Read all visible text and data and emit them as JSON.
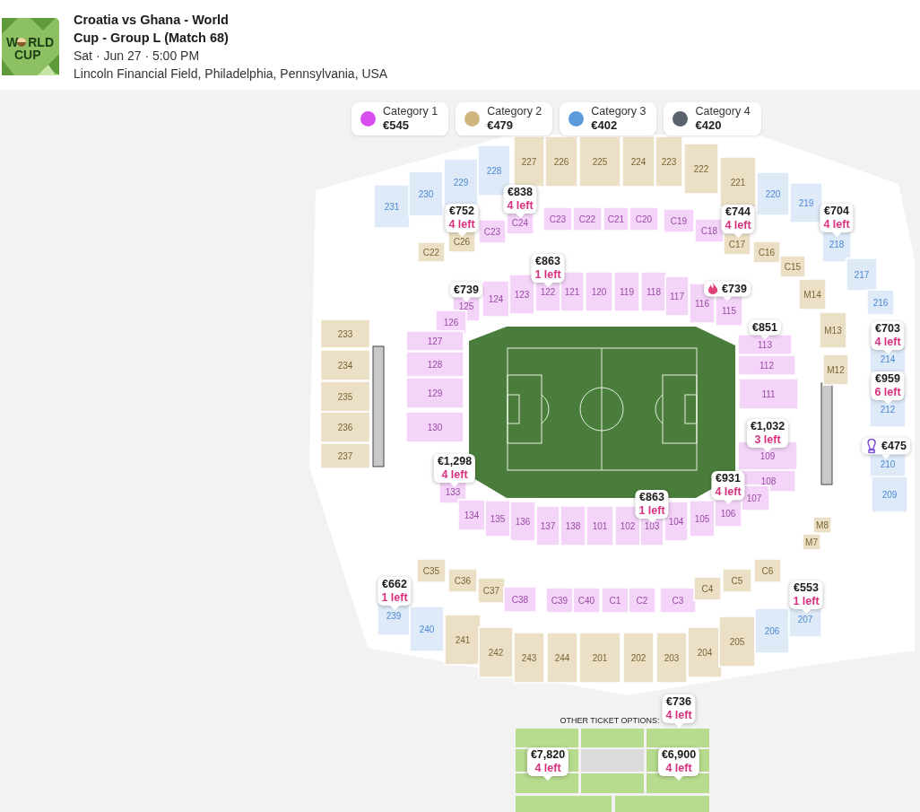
{
  "event": {
    "logo": {
      "line_1_start": "W",
      "line_1_end": "RLD",
      "line_2": "CUP"
    },
    "title": "Croatia vs Ghana - World Cup - Group L (Match 68)",
    "date": "Sat · Jun 27 · 5:00 PM",
    "venue": "Lincoln Financial Field, Philadelphia, Pennsylvania, USA"
  },
  "legend": [
    {
      "label": "Category 1",
      "price": "€545",
      "color": "#d94ef0"
    },
    {
      "label": "Category 2",
      "price": "€479",
      "color": "#cfb57e"
    },
    {
      "label": "Category 3",
      "price": "€402",
      "color": "#5b9bdc"
    },
    {
      "label": "Category 4",
      "price": "€420",
      "color": "#5a626e"
    }
  ],
  "upper_sections": [
    {
      "label": "231",
      "kind": "blue"
    },
    {
      "label": "230",
      "kind": "blue"
    },
    {
      "label": "229",
      "kind": "blue"
    },
    {
      "label": "228",
      "kind": "blue"
    },
    {
      "label": "227",
      "kind": "tan"
    },
    {
      "label": "226",
      "kind": "tan"
    },
    {
      "label": "225",
      "kind": "tan"
    },
    {
      "label": "224",
      "kind": "tan"
    },
    {
      "label": "223",
      "kind": "tan"
    },
    {
      "label": "222",
      "kind": "tan"
    },
    {
      "label": "221",
      "kind": "tan"
    },
    {
      "label": "220",
      "kind": "blue"
    },
    {
      "label": "219",
      "kind": "blue"
    },
    {
      "label": "218",
      "kind": "blue"
    },
    {
      "label": "217",
      "kind": "blue"
    },
    {
      "label": "216",
      "kind": "blue"
    },
    {
      "label": "214",
      "kind": "blue"
    },
    {
      "label": "212",
      "kind": "blue"
    },
    {
      "label": "210",
      "kind": "blue"
    },
    {
      "label": "209",
      "kind": "blue"
    },
    {
      "label": "233",
      "kind": "tan"
    },
    {
      "label": "234",
      "kind": "tan"
    },
    {
      "label": "235",
      "kind": "tan"
    },
    {
      "label": "236",
      "kind": "tan"
    },
    {
      "label": "237",
      "kind": "tan"
    },
    {
      "label": "239",
      "kind": "blue"
    },
    {
      "label": "240",
      "kind": "blue"
    },
    {
      "label": "241",
      "kind": "tan"
    },
    {
      "label": "242",
      "kind": "tan"
    },
    {
      "label": "243",
      "kind": "tan"
    },
    {
      "label": "244",
      "kind": "tan"
    },
    {
      "label": "201",
      "kind": "tan"
    },
    {
      "label": "202",
      "kind": "tan"
    },
    {
      "label": "203",
      "kind": "tan"
    },
    {
      "label": "204",
      "kind": "tan"
    },
    {
      "label": "205",
      "kind": "tan"
    },
    {
      "label": "206",
      "kind": "blue"
    },
    {
      "label": "207",
      "kind": "blue"
    }
  ],
  "club_sections": [
    {
      "label": "C22",
      "kind": "tan"
    },
    {
      "label": "C26",
      "kind": "tan"
    },
    {
      "label": "C23",
      "kind": "pink"
    },
    {
      "label": "C24",
      "kind": "pink"
    },
    {
      "label": "C23",
      "kind": "pink"
    },
    {
      "label": "C22",
      "kind": "pink"
    },
    {
      "label": "C21",
      "kind": "pink"
    },
    {
      "label": "C20",
      "kind": "pink"
    },
    {
      "label": "C19",
      "kind": "pink"
    },
    {
      "label": "C18",
      "kind": "pink"
    },
    {
      "label": "C17",
      "kind": "tan"
    },
    {
      "label": "C16",
      "kind": "tan"
    },
    {
      "label": "C15",
      "kind": "tan"
    },
    {
      "label": "M14",
      "kind": "tan"
    },
    {
      "label": "M13",
      "kind": "tan"
    },
    {
      "label": "M12",
      "kind": "tan"
    },
    {
      "label": "M8",
      "kind": "tan"
    },
    {
      "label": "M7",
      "kind": "tan"
    },
    {
      "label": "C35",
      "kind": "tan"
    },
    {
      "label": "C36",
      "kind": "tan"
    },
    {
      "label": "C37",
      "kind": "tan"
    },
    {
      "label": "C38",
      "kind": "pink"
    },
    {
      "label": "C39",
      "kind": "pink"
    },
    {
      "label": "C40",
      "kind": "pink"
    },
    {
      "label": "C1",
      "kind": "pink"
    },
    {
      "label": "C2",
      "kind": "pink"
    },
    {
      "label": "C3",
      "kind": "pink"
    },
    {
      "label": "C4",
      "kind": "tan"
    },
    {
      "label": "C5",
      "kind": "tan"
    },
    {
      "label": "C6",
      "kind": "tan"
    }
  ],
  "lower_sections": [
    {
      "label": "125",
      "kind": "pink"
    },
    {
      "label": "124",
      "kind": "pink"
    },
    {
      "label": "123",
      "kind": "pink"
    },
    {
      "label": "122",
      "kind": "pink"
    },
    {
      "label": "121",
      "kind": "pink"
    },
    {
      "label": "120",
      "kind": "pink"
    },
    {
      "label": "119",
      "kind": "pink"
    },
    {
      "label": "118",
      "kind": "pink"
    },
    {
      "label": "117",
      "kind": "pink"
    },
    {
      "label": "116",
      "kind": "pink"
    },
    {
      "label": "115",
      "kind": "pink"
    },
    {
      "label": "126",
      "kind": "pink"
    },
    {
      "label": "127",
      "kind": "pink"
    },
    {
      "label": "128",
      "kind": "pink"
    },
    {
      "label": "129",
      "kind": "pink"
    },
    {
      "label": "130",
      "kind": "pink"
    },
    {
      "label": "113",
      "kind": "pink"
    },
    {
      "label": "112",
      "kind": "pink"
    },
    {
      "label": "111",
      "kind": "pink"
    },
    {
      "label": "109",
      "kind": "pink"
    },
    {
      "label": "108",
      "kind": "pink"
    },
    {
      "label": "107",
      "kind": "pink"
    },
    {
      "label": "133",
      "kind": "pink"
    },
    {
      "label": "134",
      "kind": "pink"
    },
    {
      "label": "135",
      "kind": "pink"
    },
    {
      "label": "136",
      "kind": "pink"
    },
    {
      "label": "137",
      "kind": "pink"
    },
    {
      "label": "138",
      "kind": "pink"
    },
    {
      "label": "101",
      "kind": "pink"
    },
    {
      "label": "102",
      "kind": "pink"
    },
    {
      "label": "103",
      "kind": "pink"
    },
    {
      "label": "104",
      "kind": "pink"
    },
    {
      "label": "105",
      "kind": "pink"
    },
    {
      "label": "106",
      "kind": "pink"
    }
  ],
  "other_options": {
    "title": "OTHER TICKET OPTIONS:"
  },
  "price_pins": [
    {
      "price": "€838",
      "availability": "4 left"
    },
    {
      "price": "€752",
      "availability": "4 left"
    },
    {
      "price": "€744",
      "availability": "4 left"
    },
    {
      "price": "€704",
      "availability": "4 left"
    },
    {
      "price": "€863",
      "availability": "1 left"
    },
    {
      "price": "€739"
    },
    {
      "price": "€739",
      "kind": "hot"
    },
    {
      "price": "€851"
    },
    {
      "price": "€703",
      "availability": "4 left"
    },
    {
      "price": "€959",
      "availability": "6 left"
    },
    {
      "price": "€1,032",
      "availability": "3 left"
    },
    {
      "price": "€475",
      "kind": "prize"
    },
    {
      "price": "€1,298",
      "availability": "4 left"
    },
    {
      "price": "€931",
      "availability": "4 left"
    },
    {
      "price": "€863",
      "availability": "1 left"
    },
    {
      "price": "€662",
      "availability": "1 left"
    },
    {
      "price": "€553",
      "availability": "1 left"
    },
    {
      "price": "€736",
      "availability": "4 left"
    },
    {
      "price": "€7,820",
      "availability": "4 left"
    },
    {
      "price": "€6,900",
      "availability": "4 left"
    }
  ]
}
